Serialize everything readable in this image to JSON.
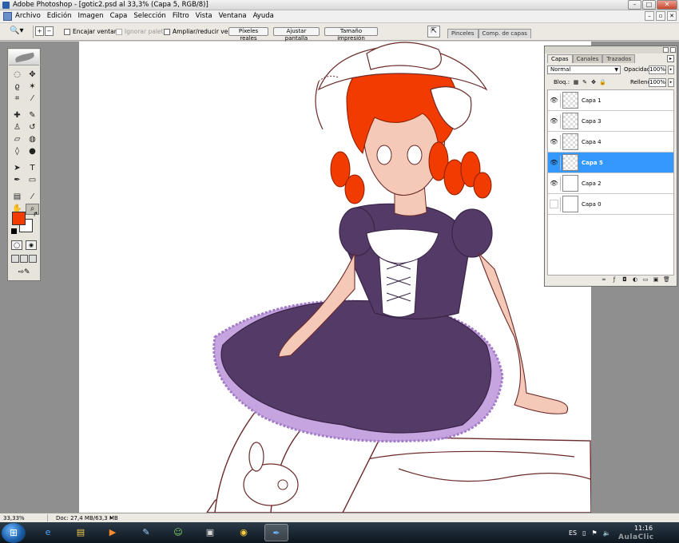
{
  "window": {
    "title": "Adobe Photoshop - [gotic2.psd al 33,3% (Capa 5, RGB/8)]"
  },
  "menu": [
    "Archivo",
    "Edición",
    "Imagen",
    "Capa",
    "Selección",
    "Filtro",
    "Vista",
    "Ventana",
    "Ayuda"
  ],
  "options": {
    "fit_window": "Encajar ventana",
    "ignore_palettes": "Ignorar paletas",
    "zoom_resize": "Ampliar/reducir vent.",
    "actual_pixels": "Píxeles reales",
    "fit_screen": "Ajustar pantalla",
    "print_size": "Tamaño impresión",
    "palette_well_tabs": [
      "Pinceles",
      "Comp. de capas"
    ]
  },
  "toolbox": {
    "foreground_color": "#f13b00",
    "background_color": "#ffffff"
  },
  "layers_palette": {
    "tabs": [
      "Capas",
      "Canales",
      "Trazados"
    ],
    "blend_mode": "Normal",
    "opacity_label": "Opacidad:",
    "opacity_value": "100%",
    "lock_label": "Bloq.:",
    "fill_label": "Relleno:",
    "fill_value": "100%",
    "layers": [
      {
        "name": "Capa 1",
        "visible": true,
        "selected": false
      },
      {
        "name": "Capa 3",
        "visible": true,
        "selected": false
      },
      {
        "name": "Capa 4",
        "visible": true,
        "selected": false
      },
      {
        "name": "Capa 5",
        "visible": true,
        "selected": true
      },
      {
        "name": "Capa 2",
        "visible": true,
        "selected": false
      },
      {
        "name": "Capa 0",
        "visible": false,
        "selected": false
      }
    ]
  },
  "status": {
    "zoom": "33,33%",
    "doc": "Doc: 27,4 MB/63,3 MB"
  },
  "taskbar": {
    "language": "ES",
    "time": "11:16",
    "watermark": "AulaClic"
  },
  "canvas": {
    "hair_color": "#f13b00",
    "dress_color": "#543a66",
    "skin_color": "#f5c9b8",
    "lace_color": "#b88ed8"
  }
}
